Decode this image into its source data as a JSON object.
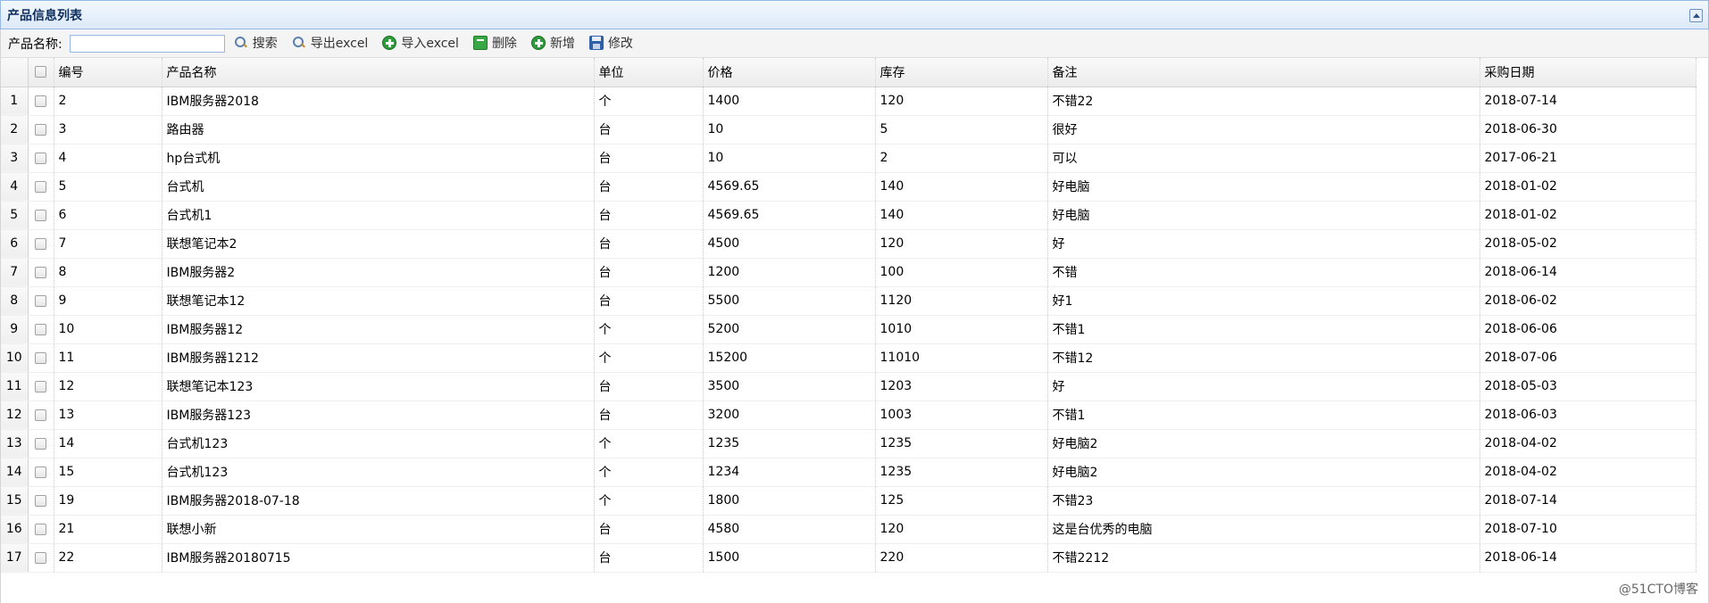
{
  "panel": {
    "title": "产品信息列表"
  },
  "toolbar": {
    "search_label": "产品名称:",
    "search_value": "",
    "buttons": [
      {
        "name": "search-button",
        "icon": "search-icon",
        "label": "搜索"
      },
      {
        "name": "export-excel-button",
        "icon": "search-icon",
        "label": "导出excel"
      },
      {
        "name": "import-excel-button",
        "icon": "plus-icon",
        "label": "导入excel"
      },
      {
        "name": "delete-button",
        "icon": "remove-icon",
        "label": "删除"
      },
      {
        "name": "add-button",
        "icon": "plus-icon",
        "label": "新增"
      },
      {
        "name": "edit-button",
        "icon": "save-icon",
        "label": "修改"
      }
    ]
  },
  "table": {
    "columns": [
      "编号",
      "产品名称",
      "单位",
      "价格",
      "库存",
      "备注",
      "采购日期"
    ],
    "rows": [
      [
        "2",
        "IBM服务器2018",
        "个",
        "1400",
        "120",
        "不错22",
        "2018-07-14"
      ],
      [
        "3",
        "路由器",
        "台",
        "10",
        "5",
        "很好",
        "2018-06-30"
      ],
      [
        "4",
        "hp台式机",
        "台",
        "10",
        "2",
        "可以",
        "2017-06-21"
      ],
      [
        "5",
        "台式机",
        "台",
        "4569.65",
        "140",
        "好电脑",
        "2018-01-02"
      ],
      [
        "6",
        "台式机1",
        "台",
        "4569.65",
        "140",
        "好电脑",
        "2018-01-02"
      ],
      [
        "7",
        "联想笔记本2",
        "台",
        "4500",
        "120",
        "好",
        "2018-05-02"
      ],
      [
        "8",
        "IBM服务器2",
        "台",
        "1200",
        "100",
        "不错",
        "2018-06-14"
      ],
      [
        "9",
        "联想笔记本12",
        "台",
        "5500",
        "1120",
        "好1",
        "2018-06-02"
      ],
      [
        "10",
        "IBM服务器12",
        "个",
        "5200",
        "1010",
        "不错1",
        "2018-06-06"
      ],
      [
        "11",
        "IBM服务器1212",
        "个",
        "15200",
        "11010",
        "不错12",
        "2018-07-06"
      ],
      [
        "12",
        "联想笔记本123",
        "台",
        "3500",
        "1203",
        "好",
        "2018-05-03"
      ],
      [
        "13",
        "IBM服务器123",
        "台",
        "3200",
        "1003",
        "不错1",
        "2018-06-03"
      ],
      [
        "14",
        "台式机123",
        "个",
        "1235",
        "1235",
        "好电脑2",
        "2018-04-02"
      ],
      [
        "15",
        "台式机123",
        "个",
        "1234",
        "1235",
        "好电脑2",
        "2018-04-02"
      ],
      [
        "19",
        "IBM服务器2018-07-18",
        "个",
        "1800",
        "125",
        "不错23",
        "2018-07-14"
      ],
      [
        "21",
        "联想小新",
        "台",
        "4580",
        "120",
        "这是台优秀的电脑",
        "2018-07-10"
      ],
      [
        "22",
        "IBM服务器20180715",
        "台",
        "1500",
        "220",
        "不错2212",
        "2018-06-14"
      ]
    ]
  },
  "watermark": "@51CTO博客"
}
